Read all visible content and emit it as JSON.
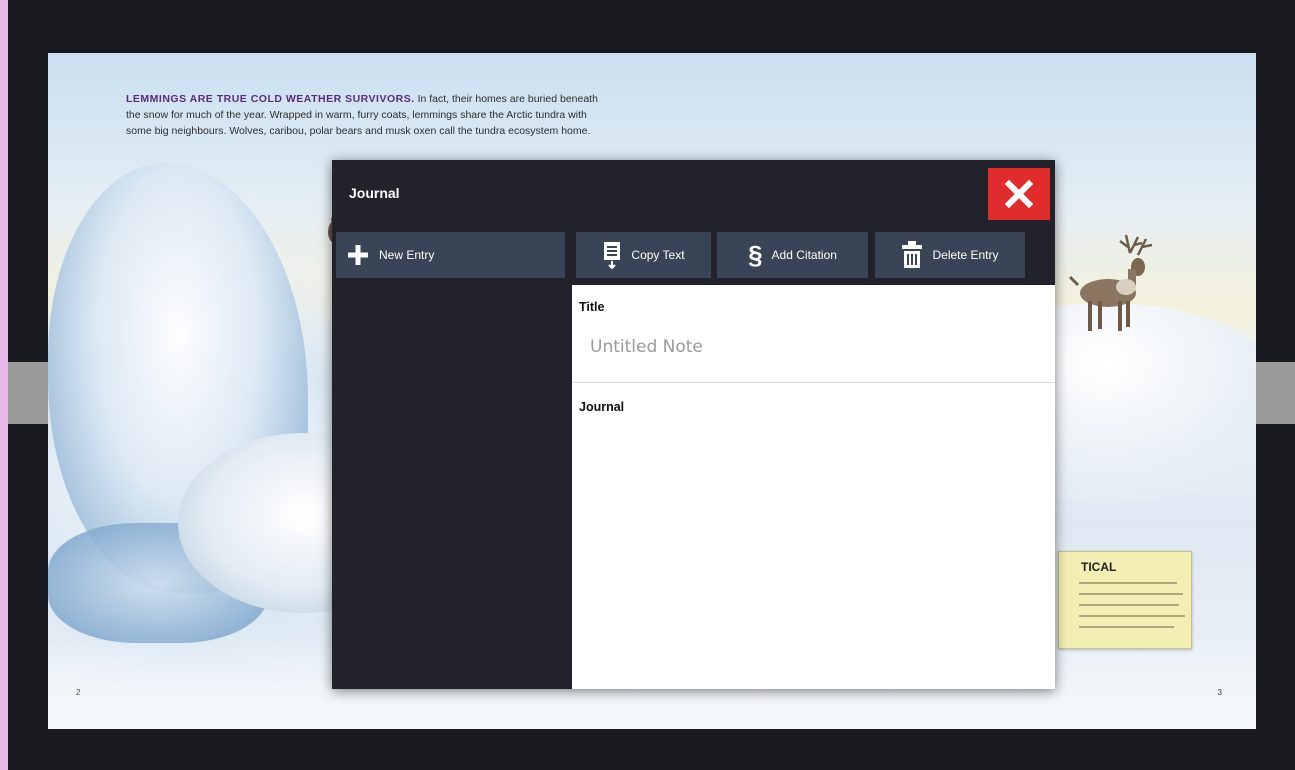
{
  "book": {
    "intro_lead": "LEMMINGS ARE TRUE COLD WEATHER SURVIVORS.",
    "intro_text": " In fact, their homes are buried beneath the snow for much of the year. Wrapped in warm, furry coats, lemmings share the Arctic tundra with some big neighbours. Wolves, caribou, polar bears and musk oxen call the tundra ecosystem home.",
    "callout_heading": "TICAL",
    "page_left": "2",
    "page_right": "3"
  },
  "dialog": {
    "title": "Journal",
    "toolbar": {
      "new_entry": "New Entry",
      "copy_text": "Copy Text",
      "add_citation": "Add Citation",
      "delete_entry": "Delete Entry"
    },
    "editor": {
      "title_label": "Title",
      "title_placeholder": "Untitled Note",
      "journal_label": "Journal"
    }
  },
  "colors": {
    "dialog_bg": "#22232a",
    "button_bg": "#3a4457",
    "close_bg": "#e02c2c"
  },
  "icons": [
    "close-icon",
    "plus-icon",
    "copy-text-icon",
    "section-sign-icon",
    "trash-icon"
  ]
}
